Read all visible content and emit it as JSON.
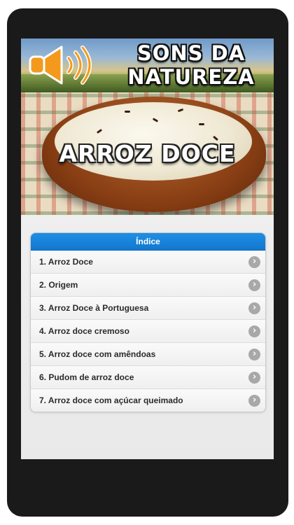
{
  "banner": {
    "title_line1": "SONS DA",
    "title_line2": "NATUREZA",
    "icon": "speaker-icon"
  },
  "hero": {
    "title": "ARROZ DOCE"
  },
  "index": {
    "header": "Índice",
    "items": [
      {
        "label": "1. Arroz Doce"
      },
      {
        "label": "2. Origem"
      },
      {
        "label": "3. Arroz Doce à Portuguesa"
      },
      {
        "label": "4. Arroz doce cremoso"
      },
      {
        "label": "5. Arroz doce com amêndoas"
      },
      {
        "label": "6. Pudom de arroz doce"
      },
      {
        "label": "7. Arroz doce com açúcar queimado"
      }
    ],
    "item_icon": "chevron-right-icon"
  },
  "colors": {
    "accent": "#1a84d9",
    "device": "#1a1a1a",
    "speaker": "#f29a1c"
  }
}
